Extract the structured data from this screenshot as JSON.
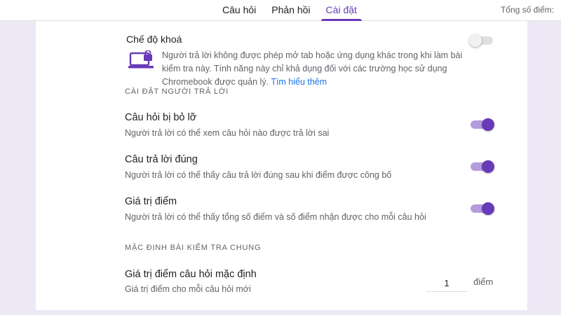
{
  "tabs": [
    {
      "label": "Câu hỏi",
      "active": false
    },
    {
      "label": "Phản hồi",
      "active": false
    },
    {
      "label": "Cài đặt",
      "active": true
    }
  ],
  "header": {
    "total_points_label": "Tổng số điểm:"
  },
  "lockdown": {
    "title": "Chế độ khoá",
    "icon": "laptop-lock-icon",
    "description": "Người trả lời không được phép mở tab hoặc ứng dụng khác trong khi làm bài kiểm tra này. Tính năng này chỉ khả dụng đối với các trường học sử dụng Chromebook được quản lý.",
    "link_text": "Tìm hiểu thêm",
    "enabled": false
  },
  "respondent_settings": {
    "section_title": "CÀI ĐẶT NGƯỜI TRẢ LỜI",
    "items": [
      {
        "title": "Câu hỏi bị bỏ lỡ",
        "description": "Người trả lời có thể xem câu hỏi nào được trả lời sai",
        "enabled": true
      },
      {
        "title": "Câu trả lời đúng",
        "description": "Người trả lời có thể thấy câu trả lời đúng sau khi điểm được công bố",
        "enabled": true
      },
      {
        "title": "Giá trị điểm",
        "description": "Người trả lời có thể thấy tổng số điểm và số điểm nhận được cho mỗi câu hỏi",
        "enabled": true
      }
    ]
  },
  "quiz_defaults": {
    "section_title": "MẶC ĐỊNH BÀI KIỂM TRA CHUNG",
    "default_points": {
      "title": "Giá trị điểm câu hỏi mặc định",
      "description": "Giá trị điểm cho mỗi câu hỏi mới",
      "value": "1",
      "unit": "điểm"
    }
  },
  "colors": {
    "accent": "#673ab7",
    "accent_light": "#b39ddb",
    "background": "#ede7f6",
    "link": "#1a73e8"
  }
}
